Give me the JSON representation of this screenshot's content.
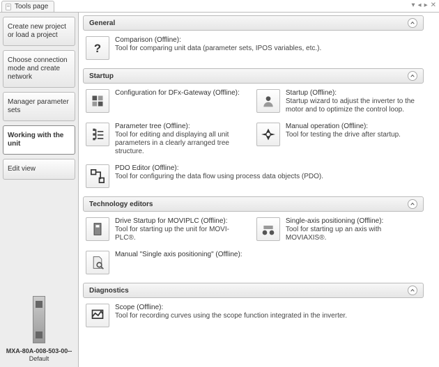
{
  "tab_title": "Tools page",
  "sidebar": {
    "items": [
      {
        "label": "Create new project or load a project"
      },
      {
        "label": "Choose connection mode and create network"
      },
      {
        "label": "Manager parameter sets"
      },
      {
        "label": "Working with the unit"
      },
      {
        "label": "Edit view"
      }
    ],
    "active_index": 3,
    "device": {
      "name": "MXA-80A-008-503-00--",
      "subtitle": "Default"
    }
  },
  "sections": [
    {
      "title": "General",
      "items": [
        {
          "icon": "question",
          "title": "Comparison (Offline):",
          "desc": "Tool for comparing unit data (parameter sets, IPOS variables, etc.)."
        }
      ]
    },
    {
      "title": "Startup",
      "items": [
        {
          "icon": "config",
          "title": "Configuration for DFx-Gateway (Offline):",
          "desc": ""
        },
        {
          "icon": "startup",
          "title": "Startup (Offline):",
          "desc": "Startup wizard to adjust the inverter to the motor and to optimize the control loop."
        },
        {
          "icon": "tree",
          "title": "Parameter tree (Offline):",
          "desc": "Tool for editing and displaying all unit parameters in a clearly arranged tree structure."
        },
        {
          "icon": "manual",
          "title": "Manual operation (Offline):",
          "desc": "Tool for testing the drive after startup."
        },
        {
          "icon": "pdo",
          "title": "PDO Editor (Offline):",
          "desc": "Tool for configuring the data flow using process data objects (PDO)."
        }
      ]
    },
    {
      "title": "Technology editors",
      "items": [
        {
          "icon": "drive",
          "title": "Drive Startup for MOVIPLC (Offline):",
          "desc": "Tool for starting up the unit for MOVI-PLC®."
        },
        {
          "icon": "axis",
          "title": "Single-axis positioning (Offline):",
          "desc": "Tool for starting up an axis with MOVIAXIS®."
        },
        {
          "icon": "doc",
          "title": "Manual \"Single axis positioning\" (Offline):",
          "desc": ""
        }
      ]
    },
    {
      "title": "Diagnostics",
      "items": [
        {
          "icon": "scope",
          "title": "Scope (Offline):",
          "desc": "Tool for recording curves using the scope function integrated in the inverter."
        }
      ]
    }
  ]
}
